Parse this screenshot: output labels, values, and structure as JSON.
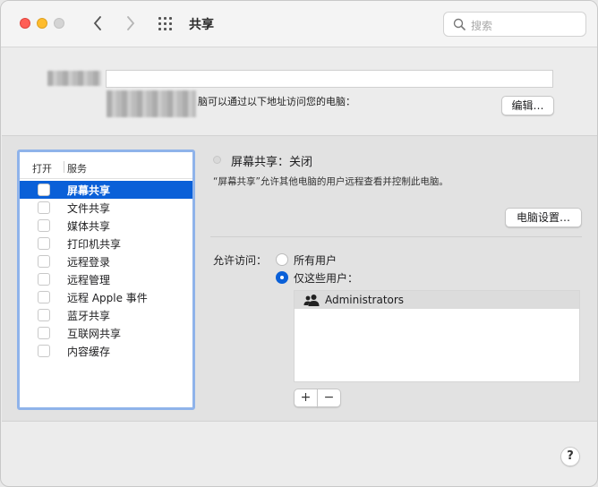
{
  "window": {
    "title": "共享",
    "search_placeholder": "搜索"
  },
  "computer": {
    "address_text": "脑可以通过以下地址访问您的电脑：",
    "edit_button": "编辑…"
  },
  "services": {
    "col_open": "打开",
    "col_service": "服务",
    "items": [
      {
        "label": "屏幕共享",
        "checked": false,
        "selected": true
      },
      {
        "label": "文件共享",
        "checked": false,
        "selected": false
      },
      {
        "label": "媒体共享",
        "checked": false,
        "selected": false
      },
      {
        "label": "打印机共享",
        "checked": false,
        "selected": false
      },
      {
        "label": "远程登录",
        "checked": false,
        "selected": false
      },
      {
        "label": "远程管理",
        "checked": false,
        "selected": false
      },
      {
        "label": "远程 Apple 事件",
        "checked": false,
        "selected": false
      },
      {
        "label": "蓝牙共享",
        "checked": false,
        "selected": false
      },
      {
        "label": "互联网共享",
        "checked": false,
        "selected": false
      },
      {
        "label": "内容缓存",
        "checked": false,
        "selected": false
      }
    ]
  },
  "detail": {
    "status": "屏幕共享：关闭",
    "description": "“屏幕共享”允许其他电脑的用户远程查看并控制此电脑。",
    "computer_settings_button": "电脑设置…",
    "access_label": "允许访问：",
    "radio_all": "所有用户",
    "radio_only": "仅这些用户：",
    "selected_option": "only",
    "users": [
      {
        "name": "Administrators",
        "icon": "group-icon"
      }
    ],
    "add_label": "+",
    "remove_label": "−"
  },
  "help_label": "?",
  "colors": {
    "accent": "#0a60d8",
    "close": "#ff5f57",
    "minimize": "#febc2e"
  }
}
